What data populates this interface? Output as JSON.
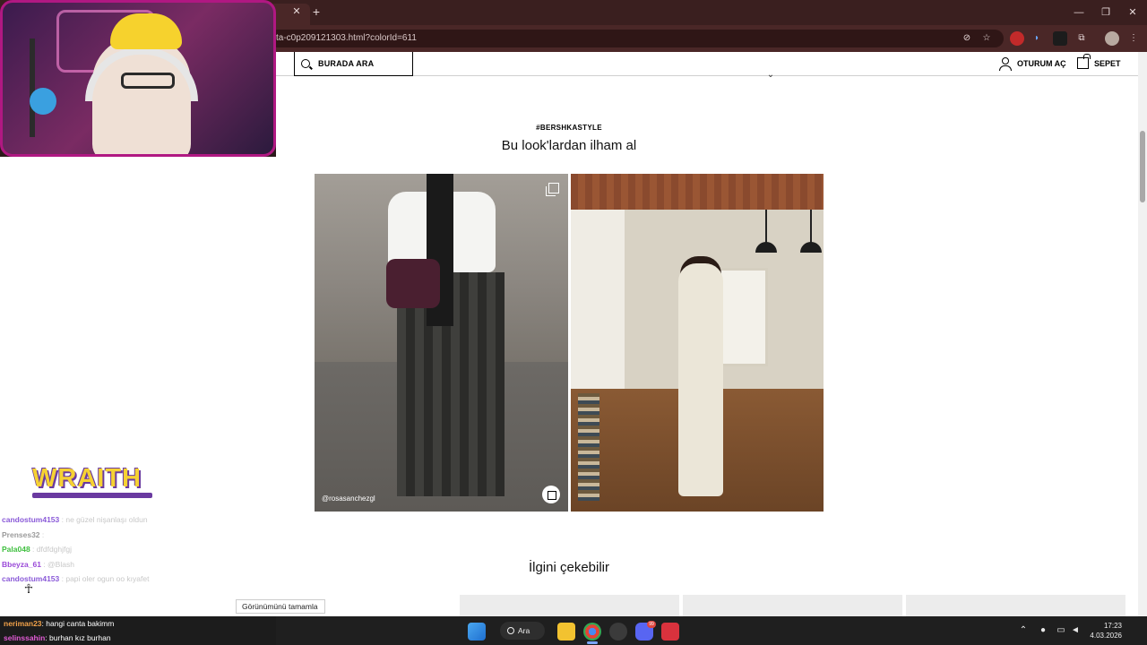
{
  "browser": {
    "tab_close": "✕",
    "tab_new": "+",
    "url": "ta-c0p209121303.html?colorId=611",
    "window_controls": [
      "—",
      "❐",
      "✕"
    ]
  },
  "header": {
    "search_label": "BURADA ARA",
    "login_label": "OTURUM AÇ",
    "cart_label": "SEPET"
  },
  "inspiration": {
    "hashtag": "#BERSHKASTYLE",
    "title": "Bu look'lardan ilham al",
    "looks": [
      {
        "caption": "@rosasanchezgl"
      },
      {
        "caption": ""
      }
    ]
  },
  "recommendations": {
    "title": "İlgini çekebilir"
  },
  "overlay": {
    "logo_text": "WRAITH",
    "chat": [
      {
        "user": "candostum4153",
        "message": ": ne güzel nişanlaşı oldun",
        "color": "#8a5ad8"
      },
      {
        "user": "Prenses32",
        "message": ":",
        "color": "#9b9b9b"
      },
      {
        "user": "Pala048",
        "message": ": dfdfdghjfgj",
        "color": "#3fbf3f"
      },
      {
        "user": "Bbeyza_61",
        "message": ": @Blash",
        "color": "#9a4ad8"
      },
      {
        "user": "candostum4153",
        "message": ": papi oler ogun oo kıyafet",
        "color": "#8a5ad8"
      }
    ],
    "dark_chat": [
      {
        "user": "neriman23",
        "message": ": hangi canta bakimm"
      },
      {
        "user": "selinssahin",
        "message": ": burhan kız burhan"
      }
    ],
    "tooltip": "Görünümünü tamamla"
  },
  "taskbar": {
    "search_label": "Ara",
    "time": "17:23",
    "date": "4.03.2026",
    "notif_count": "99"
  }
}
